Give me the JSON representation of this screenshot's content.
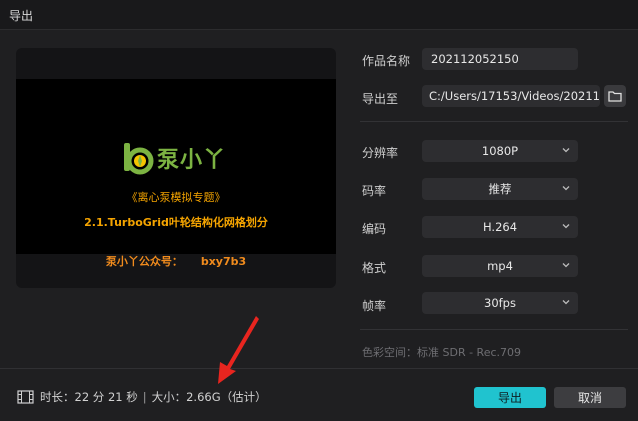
{
  "window": {
    "title": "导出"
  },
  "preview": {
    "logo_text": "泵小丫",
    "line1": "《离心泵模拟专题》",
    "line2": "2.1.TurboGrid叶轮结构化网格划分",
    "line3_label": "泵小丫公众号：",
    "line3_code": "bxy7b3"
  },
  "form": {
    "name_label": "作品名称",
    "name_value": "202112052150",
    "export_to_label": "导出至",
    "export_to_value": "C:/Users/17153/Videos/20211...",
    "resolution_label": "分辨率",
    "resolution_value": "1080P",
    "bitrate_label": "码率",
    "bitrate_value": "推荐",
    "codec_label": "编码",
    "codec_value": "H.264",
    "format_label": "格式",
    "format_value": "mp4",
    "framerate_label": "帧率",
    "framerate_value": "30fps",
    "colorspace_text": "色彩空间：标准 SDR - Rec.709"
  },
  "footer": {
    "duration_text": "时长：22 分 21 秒",
    "separator": "|",
    "size_text": "大小：2.66G（估计）",
    "export_button": "导出",
    "cancel_button": "取消"
  },
  "colors": {
    "accent": "#20c3cf",
    "annotation_arrow": "#e8251f",
    "logo_green": "#7cb342",
    "video_text": "#f5a400"
  },
  "icons": [
    "folder-icon",
    "chevron-down-icon",
    "film-icon",
    "red-arrow-annotation"
  ]
}
